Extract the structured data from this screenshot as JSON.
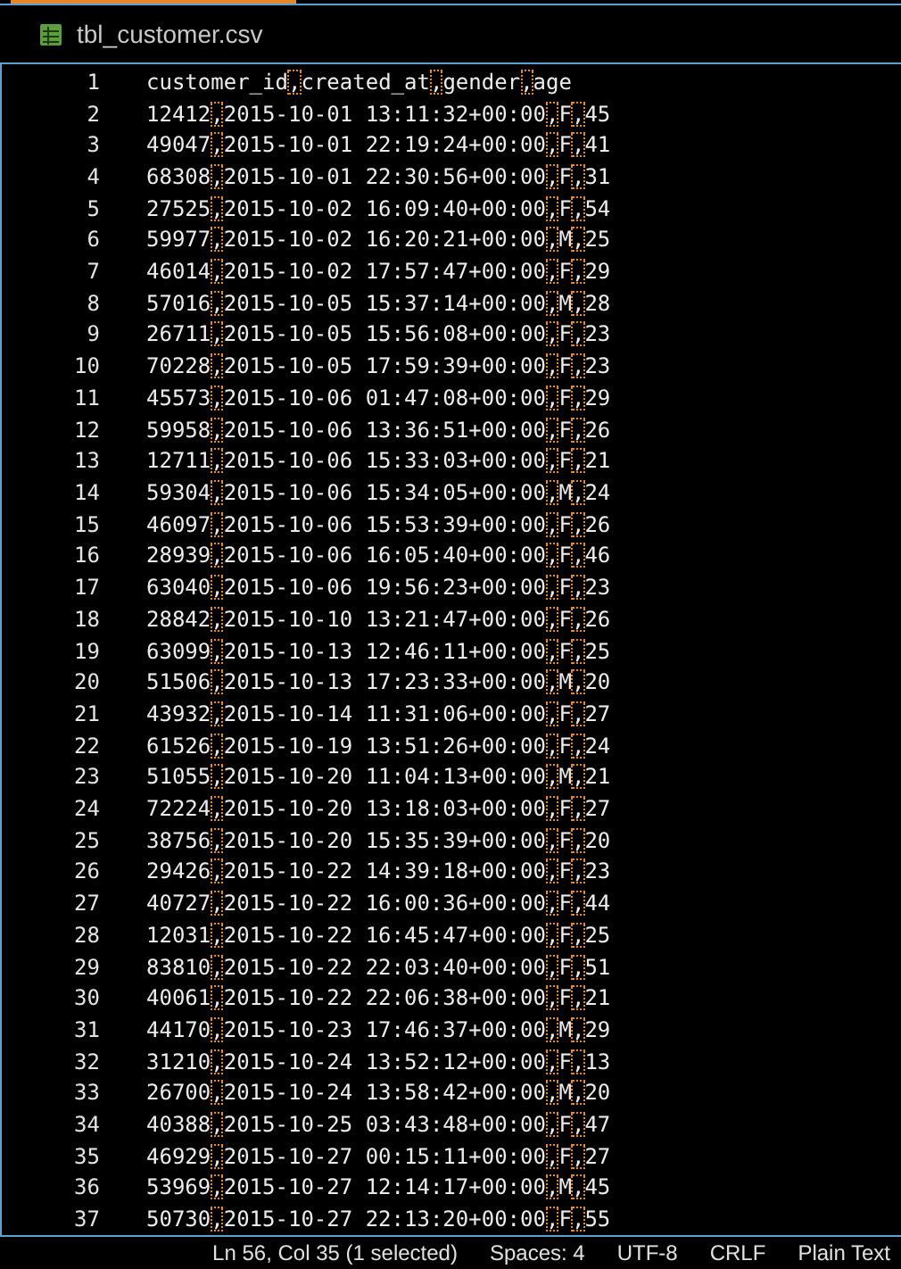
{
  "tab": {
    "title": "tbl_customer.csv"
  },
  "lines": [
    {
      "number": "1",
      "text": "customer_id,created_at,gender,age"
    },
    {
      "number": "2",
      "text": "12412,2015-10-01 13:11:32+00:00,F,45"
    },
    {
      "number": "3",
      "text": "49047,2015-10-01 22:19:24+00:00,F,41"
    },
    {
      "number": "4",
      "text": "68308,2015-10-01 22:30:56+00:00,F,31"
    },
    {
      "number": "5",
      "text": "27525,2015-10-02 16:09:40+00:00,F,54"
    },
    {
      "number": "6",
      "text": "59977,2015-10-02 16:20:21+00:00,M,25"
    },
    {
      "number": "7",
      "text": "46014,2015-10-02 17:57:47+00:00,F,29"
    },
    {
      "number": "8",
      "text": "57016,2015-10-05 15:37:14+00:00,M,28"
    },
    {
      "number": "9",
      "text": "26711,2015-10-05 15:56:08+00:00,F,23"
    },
    {
      "number": "10",
      "text": "70228,2015-10-05 17:59:39+00:00,F,23"
    },
    {
      "number": "11",
      "text": "45573,2015-10-06 01:47:08+00:00,F,29"
    },
    {
      "number": "12",
      "text": "59958,2015-10-06 13:36:51+00:00,F,26"
    },
    {
      "number": "13",
      "text": "12711,2015-10-06 15:33:03+00:00,F,21"
    },
    {
      "number": "14",
      "text": "59304,2015-10-06 15:34:05+00:00,M,24"
    },
    {
      "number": "15",
      "text": "46097,2015-10-06 15:53:39+00:00,F,26"
    },
    {
      "number": "16",
      "text": "28939,2015-10-06 16:05:40+00:00,F,46"
    },
    {
      "number": "17",
      "text": "63040,2015-10-06 19:56:23+00:00,F,23"
    },
    {
      "number": "18",
      "text": "28842,2015-10-10 13:21:47+00:00,F,26"
    },
    {
      "number": "19",
      "text": "63099,2015-10-13 12:46:11+00:00,F,25"
    },
    {
      "number": "20",
      "text": "51506,2015-10-13 17:23:33+00:00,M,20"
    },
    {
      "number": "21",
      "text": "43932,2015-10-14 11:31:06+00:00,F,27"
    },
    {
      "number": "22",
      "text": "61526,2015-10-19 13:51:26+00:00,F,24"
    },
    {
      "number": "23",
      "text": "51055,2015-10-20 11:04:13+00:00,M,21"
    },
    {
      "number": "24",
      "text": "72224,2015-10-20 13:18:03+00:00,F,27"
    },
    {
      "number": "25",
      "text": "38756,2015-10-20 15:35:39+00:00,F,20"
    },
    {
      "number": "26",
      "text": "29426,2015-10-22 14:39:18+00:00,F,23"
    },
    {
      "number": "27",
      "text": "40727,2015-10-22 16:00:36+00:00,F,44"
    },
    {
      "number": "28",
      "text": "12031,2015-10-22 16:45:47+00:00,F,25"
    },
    {
      "number": "29",
      "text": "83810,2015-10-22 22:03:40+00:00,F,51"
    },
    {
      "number": "30",
      "text": "40061,2015-10-22 22:06:38+00:00,F,21"
    },
    {
      "number": "31",
      "text": "44170,2015-10-23 17:46:37+00:00,M,29"
    },
    {
      "number": "32",
      "text": "31210,2015-10-24 13:52:12+00:00,F,13"
    },
    {
      "number": "33",
      "text": "26700,2015-10-24 13:58:42+00:00,M,20"
    },
    {
      "number": "34",
      "text": "40388,2015-10-25 03:43:48+00:00,F,47"
    },
    {
      "number": "35",
      "text": "46929,2015-10-27 00:15:11+00:00,F,27"
    },
    {
      "number": "36",
      "text": "53969,2015-10-27 12:14:17+00:00,M,45"
    },
    {
      "number": "37",
      "text": "50730,2015-10-27 22:13:20+00:00,F,55"
    }
  ],
  "status_bar": [
    "Ln 56, Col 35 (1 selected)",
    "Spaces: 4",
    "UTF-8",
    "CRLF",
    "Plain Text"
  ]
}
